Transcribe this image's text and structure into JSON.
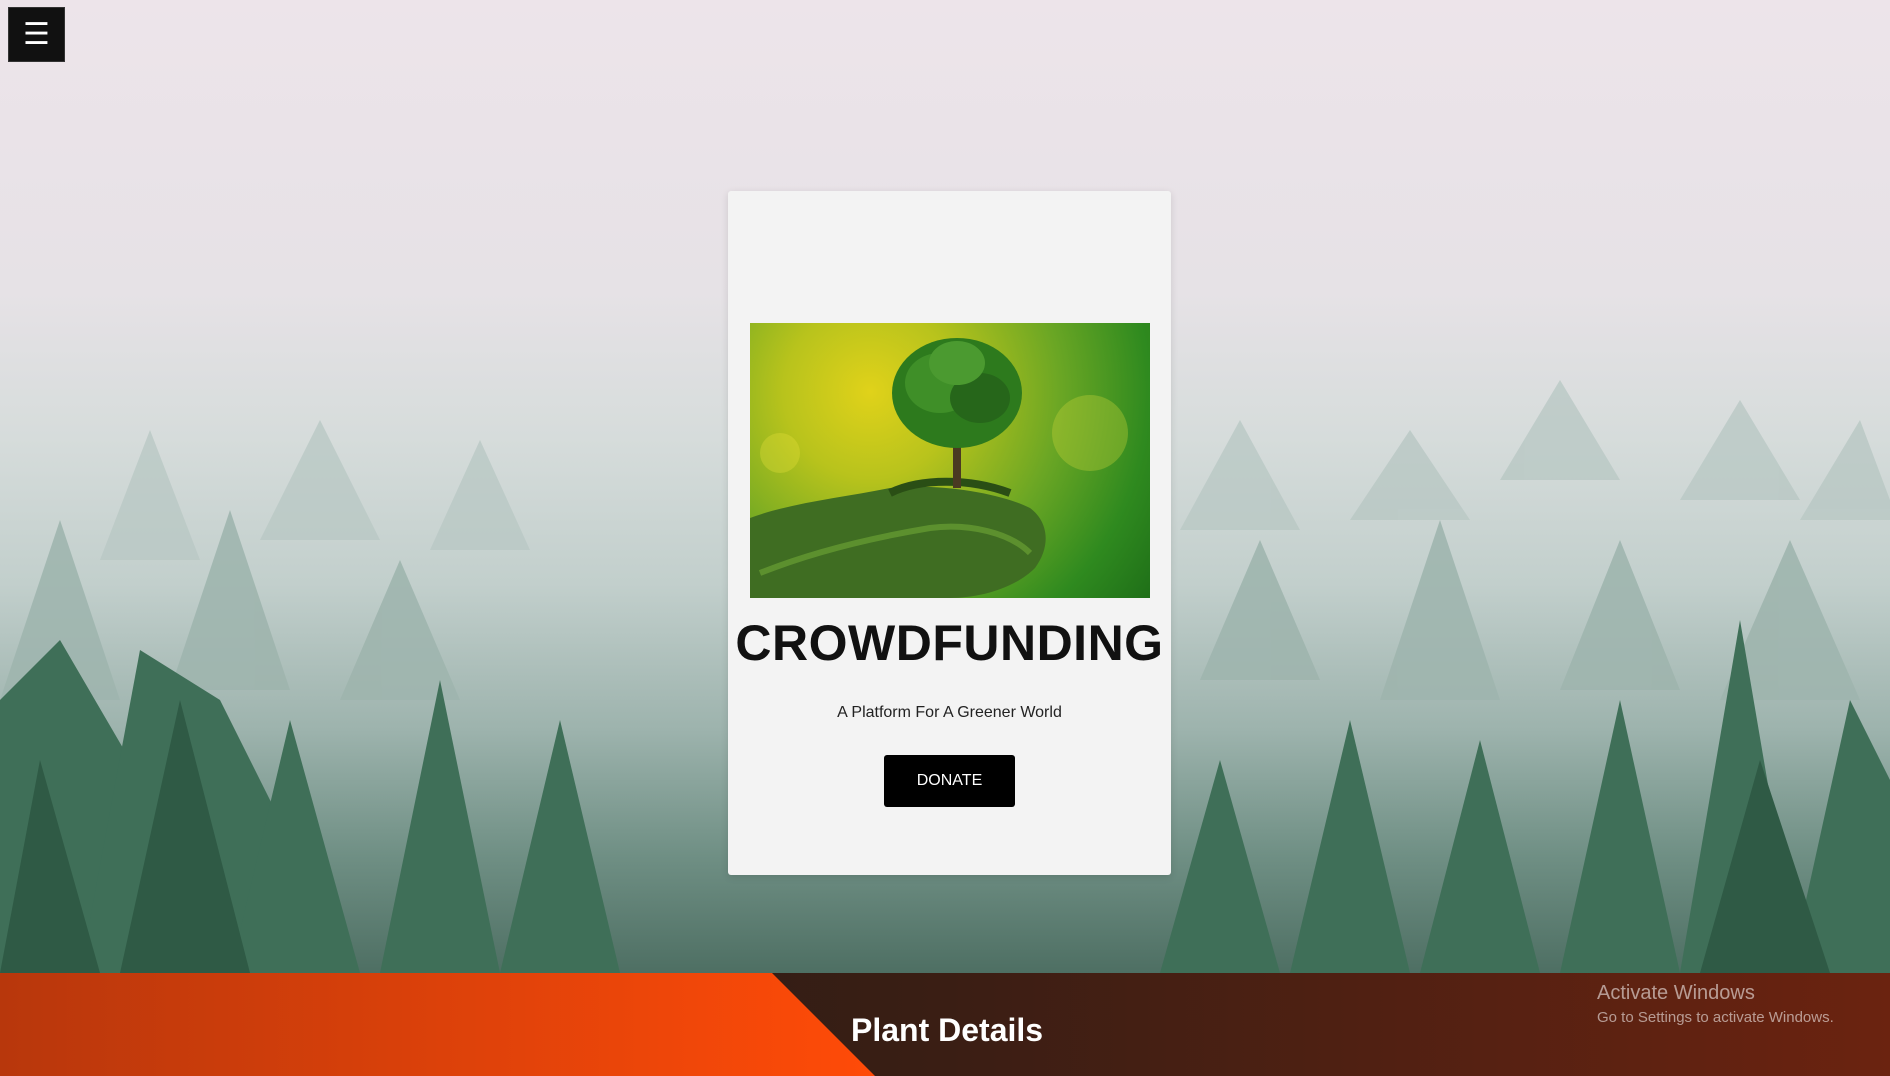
{
  "menu": {
    "icon": "hamburger-icon",
    "glyph": "☰"
  },
  "card": {
    "image": "tree-in-hand-image",
    "title": "CROWDFUNDING",
    "subtitle": "A Platform For A Greener World",
    "donate_label": "DONATE"
  },
  "banner": {
    "title": "Plant Details"
  },
  "watermark": {
    "line1": "Activate Windows",
    "line2": "Go to Settings to activate Windows."
  },
  "colors": {
    "banner_accent": "#f24a0a",
    "button_bg": "#000000",
    "card_bg": "#f3f3f3"
  }
}
